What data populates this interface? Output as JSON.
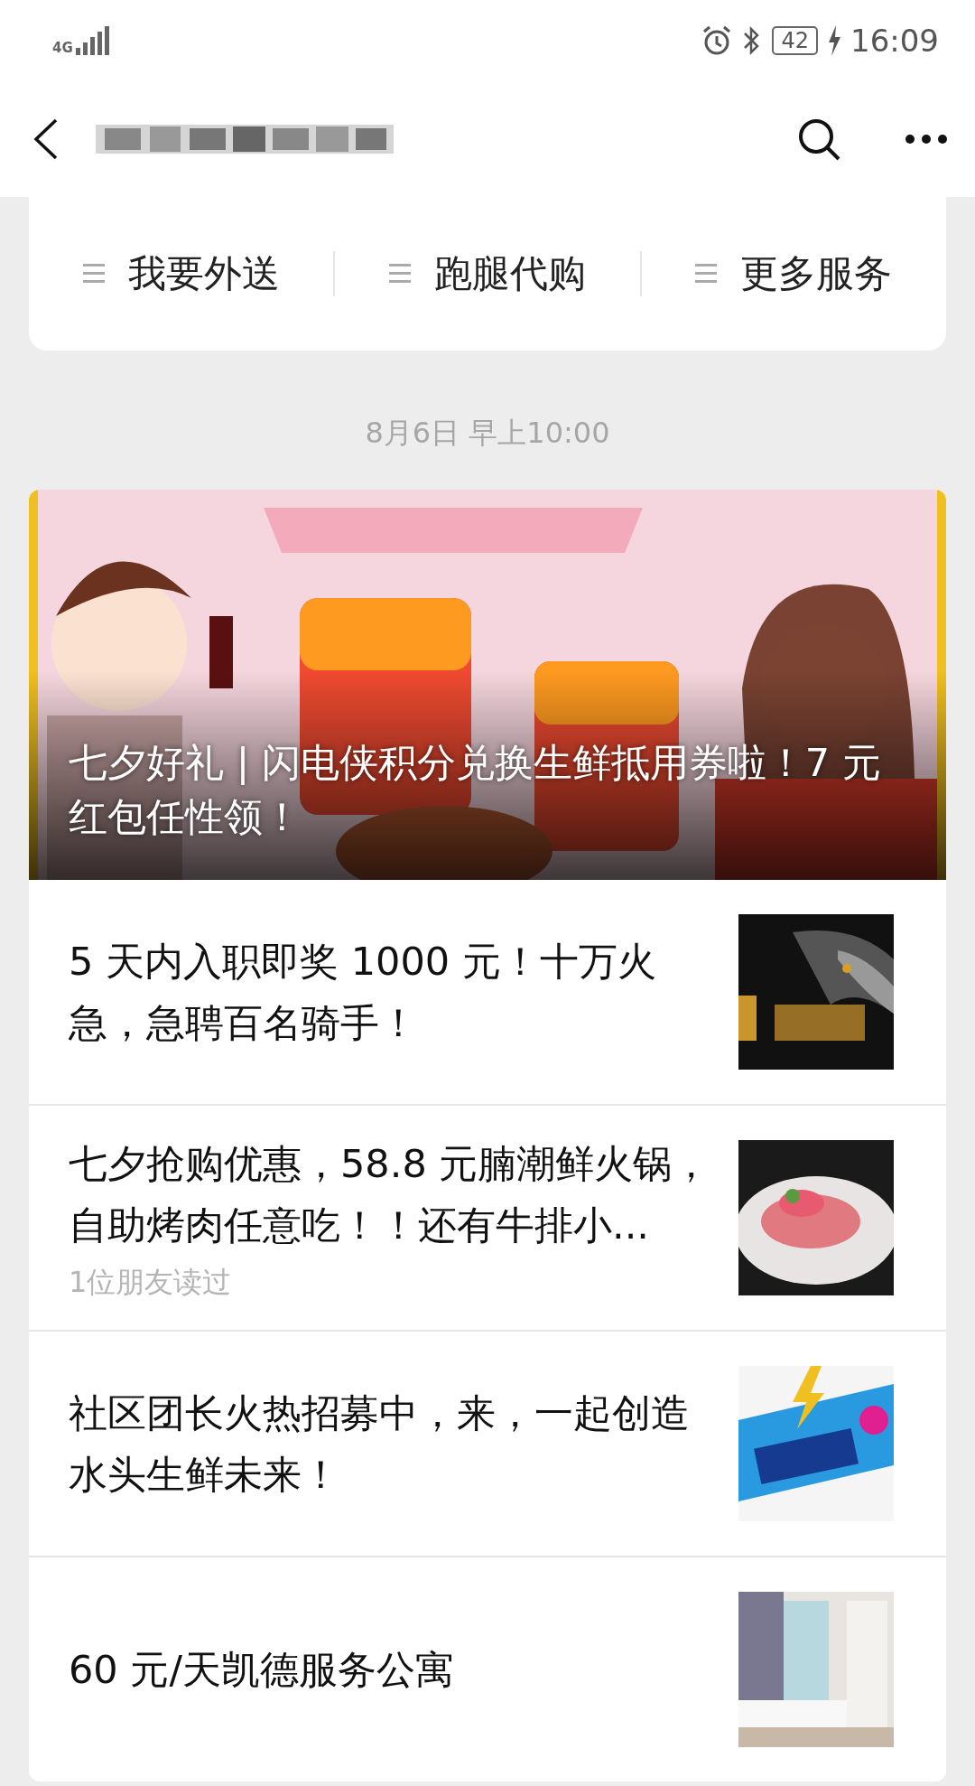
{
  "status_bar": {
    "network": "4G",
    "battery": "42",
    "time": "16:09"
  },
  "menu": [
    {
      "label": "我要外送"
    },
    {
      "label": "跑腿代购"
    },
    {
      "label": "更多服务"
    }
  ],
  "date": "8月6日 早上10:00",
  "cover": {
    "kind": "picture",
    "title": "七夕好礼 | 闪电侠积分兑换生鲜抵用券啦！7 元红包任性领！"
  },
  "articles": [
    {
      "title": "5 天内入职即奖 1000 元！十万火急，急聘百名骑手！"
    },
    {
      "title": "七夕抢购优惠，58.8 元腩潮鲜火锅，自助烤肉任意吃！！还有牛排小...",
      "note": "1位朋友读过"
    },
    {
      "title": "社区团长火热招募中，来，一起创造水头生鲜未来！"
    },
    {
      "title": "60 元/天凯德服务公寓"
    }
  ]
}
